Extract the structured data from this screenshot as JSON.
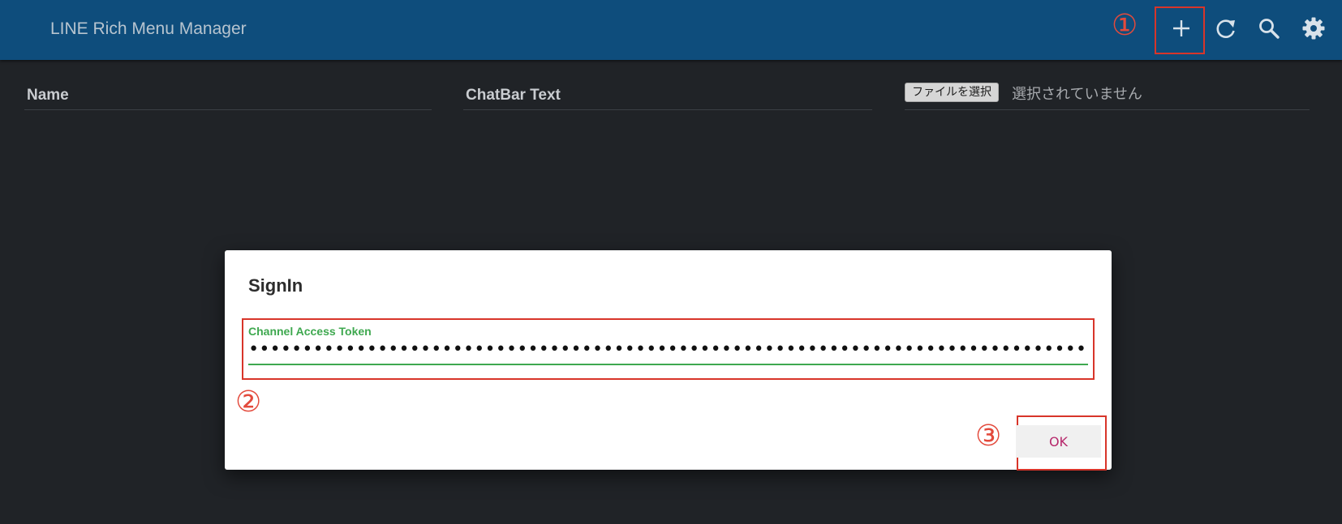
{
  "app": {
    "title": "LINE Rich Menu Manager"
  },
  "toolbar": {
    "icons": [
      "add-icon",
      "refresh-icon",
      "search-icon",
      "settings-icon"
    ]
  },
  "form": {
    "name_label": "Name",
    "chatbar_label": "ChatBar Text",
    "file_button_label": "ファイルを選択",
    "file_status": "選択されていません"
  },
  "dialog": {
    "title": "SignIn",
    "token_label": "Channel Access Token",
    "token_value": "••••••••••••••••••••••••••••••••••••••••••••••••••••••••••••••••••••••••••••••••••••••••••••••••••••••••••••••••••••••••••••••••••••••••••••••••••••••••••",
    "ok_label": "OK"
  },
  "annotations": {
    "step1": "①",
    "step2": "②",
    "step3": "③"
  },
  "colors": {
    "topbar": "#0e4d7c",
    "background": "#202327",
    "accent_green": "#3ea84f",
    "ok_text": "#b6286b",
    "annotation_red": "#d8352a"
  }
}
